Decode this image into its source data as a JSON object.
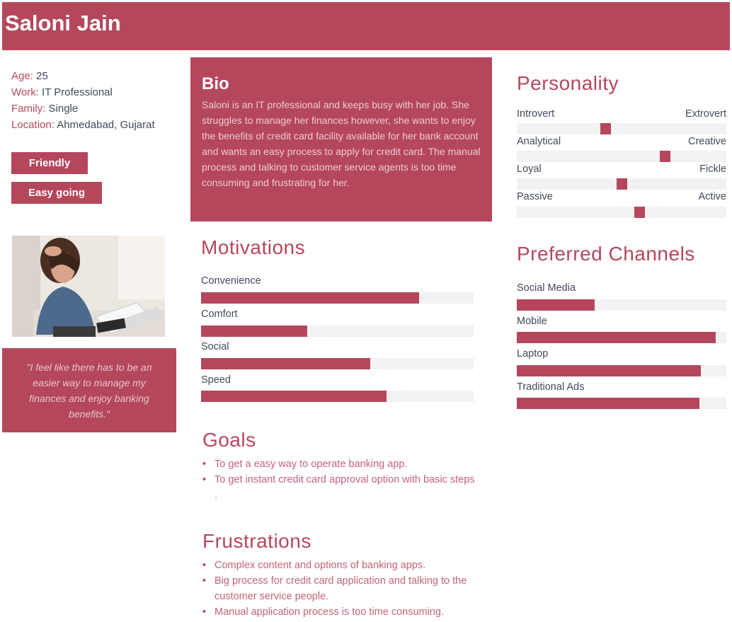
{
  "persona": {
    "name": "Saloni Jain",
    "details": [
      {
        "label": "Age:",
        "value": " 25"
      },
      {
        "label": "Work:",
        "value": " IT Professional"
      },
      {
        "label": "Family:",
        "value": " Single"
      },
      {
        "label": "Location:",
        "value": " Ahmedabad, Gujarat"
      }
    ],
    "tags": [
      "Friendly",
      "Easy going"
    ],
    "quote": "\"I feel like there has to be an easier way to manage my finances and enjoy banking benefits.\""
  },
  "bio": {
    "title": "Bio",
    "text": "Saloni is an IT professional and keeps busy with her job. She struggles to manage her finances however, she wants to enjoy the benefits of credit card facility available for her bank account and wants an easy process to apply for credit card. The manual process and talking to customer service agents is too time consuming and frustrating for her."
  },
  "motivations": {
    "title": "Motivations",
    "items": [
      {
        "label": "Convenience",
        "level": 0.8
      },
      {
        "label": "Comfort",
        "level": 0.39
      },
      {
        "label": "Social",
        "level": 0.62
      },
      {
        "label": "Speed",
        "level": 0.68
      }
    ]
  },
  "goals": {
    "title": "Goals",
    "items": [
      "To get a easy way to operate banking app.",
      "To get instant credit card approval option with basic steps ."
    ]
  },
  "frustrations": {
    "title": "Frustrations",
    "items": [
      "Complex content and options of banking apps.",
      "Big process for credit card application and talking to the customer service people.",
      "Manual application process is too time consuming."
    ]
  },
  "personality": {
    "title": "Personality",
    "traits": [
      {
        "left": "Introvert",
        "right": "Extrovert",
        "level": 0.42
      },
      {
        "left": "Analytical",
        "right": "Creative",
        "level": 0.72
      },
      {
        "left": "Loyal",
        "right": "Fickle",
        "level": 0.5
      },
      {
        "left": "Passive",
        "right": "Active",
        "level": 0.59
      }
    ]
  },
  "channels": {
    "title": "Preferred Channels",
    "items": [
      {
        "label": "Social Media",
        "level": 0.37
      },
      {
        "label": "Mobile",
        "level": 0.95
      },
      {
        "label": "Laptop",
        "level": 0.88
      },
      {
        "label": "Traditional Ads",
        "level": 0.87
      }
    ]
  },
  "colors": {
    "accent": "#b5475d",
    "track": "#f2f2f2",
    "text": "#3f4a5c"
  }
}
